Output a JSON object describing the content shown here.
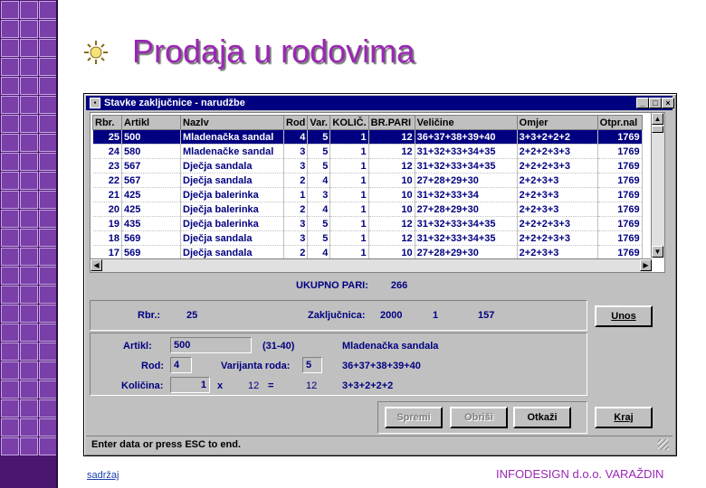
{
  "slide": {
    "title": "Prodaja u rodovima",
    "footer_left": "sadržaj",
    "footer_right": "INFODESIGN d.o.o. VARAŽDIN",
    "accent_color": "#9b26b6",
    "stripe_color": "#4a1670",
    "bullet_icon": "sun-bullet-icon"
  },
  "window": {
    "title": "Stavke zaključnice - narudžbe",
    "controls": [
      "_",
      "□",
      "×"
    ]
  },
  "table": {
    "columns": [
      "Rbr.",
      "Artikl",
      "Nazlv",
      "Rod",
      "Var.",
      "KOLIČ.",
      "BR.PARI",
      "Veličine",
      "Omjer",
      "Otpr.nal"
    ],
    "rows": [
      {
        "rbr": "25",
        "artikl": "500",
        "naziv": "Mladenačka sandal",
        "rod": "4",
        "var": "5",
        "kol": "1",
        "brpari": "12",
        "velicine": "36+37+38+39+40",
        "omjer": "3+3+2+2+2",
        "otpr": "1769",
        "selected": true
      },
      {
        "rbr": "24",
        "artikl": "580",
        "naziv": "Mladenačke sandal",
        "rod": "3",
        "var": "5",
        "kol": "1",
        "brpari": "12",
        "velicine": "31+32+33+34+35",
        "omjer": "2+2+2+3+3",
        "otpr": "1769"
      },
      {
        "rbr": "23",
        "artikl": "567",
        "naziv": "Dječja sandala",
        "rod": "3",
        "var": "5",
        "kol": "1",
        "brpari": "12",
        "velicine": "31+32+33+34+35",
        "omjer": "2+2+2+3+3",
        "otpr": "1769"
      },
      {
        "rbr": "22",
        "artikl": "567",
        "naziv": "Dječja sandala",
        "rod": "2",
        "var": "4",
        "kol": "1",
        "brpari": "10",
        "velicine": "27+28+29+30",
        "omjer": "2+2+3+3",
        "otpr": "1769"
      },
      {
        "rbr": "21",
        "artikl": "425",
        "naziv": "Dječja balerinka",
        "rod": "1",
        "var": "3",
        "kol": "1",
        "brpari": "10",
        "velicine": "31+32+33+34",
        "omjer": "2+2+3+3",
        "otpr": "1769"
      },
      {
        "rbr": "20",
        "artikl": "425",
        "naziv": "Dječja balerinka",
        "rod": "2",
        "var": "4",
        "kol": "1",
        "brpari": "10",
        "velicine": "27+28+29+30",
        "omjer": "2+2+3+3",
        "otpr": "1769"
      },
      {
        "rbr": "19",
        "artikl": "435",
        "naziv": "Dječja balerinka",
        "rod": "3",
        "var": "5",
        "kol": "1",
        "brpari": "12",
        "velicine": "31+32+33+34+35",
        "omjer": "2+2+2+3+3",
        "otpr": "1769"
      },
      {
        "rbr": "18",
        "artikl": "569",
        "naziv": "Dječja sandala",
        "rod": "3",
        "var": "5",
        "kol": "1",
        "brpari": "12",
        "velicine": "31+32+33+34+35",
        "omjer": "2+2+2+3+3",
        "otpr": "1769"
      },
      {
        "rbr": "17",
        "artikl": "569",
        "naziv": "Dječja sandala",
        "rod": "2",
        "var": "4",
        "kol": "1",
        "brpari": "10",
        "velicine": "27+28+29+30",
        "omjer": "2+2+3+3",
        "otpr": "1769"
      }
    ]
  },
  "totals": {
    "label": "UKUPNO PARI:",
    "value": "266"
  },
  "header_panel": {
    "rbr_label": "Rbr.:",
    "rbr_value": "25",
    "zak_label": "Zaključnica:",
    "zak_year": "2000",
    "zak_num": "1",
    "zak_id": "157"
  },
  "detail_panel": {
    "artikl_label": "Artikl:",
    "artikl_value": "500",
    "size_range": "(31-40)",
    "artikl_name": "Mladenačka sandala",
    "rod_label": "Rod:",
    "rod_value": "4",
    "var_label": "Varijanta roda:",
    "var_value": "5",
    "var_sizes": "36+37+38+39+40",
    "kol_label": "Količina:",
    "kol_value": "1",
    "mult": "x",
    "pairs": "12",
    "eq": "=",
    "total_pairs": "12",
    "ratio": "3+3+2+2+2"
  },
  "buttons": {
    "unos": "Unos",
    "spremi": "Spremi",
    "obrisi": "Obriši",
    "otkazi": "Otkaži",
    "kraj": "Kraj"
  },
  "status": {
    "text": "Enter data or press ESC to end."
  }
}
